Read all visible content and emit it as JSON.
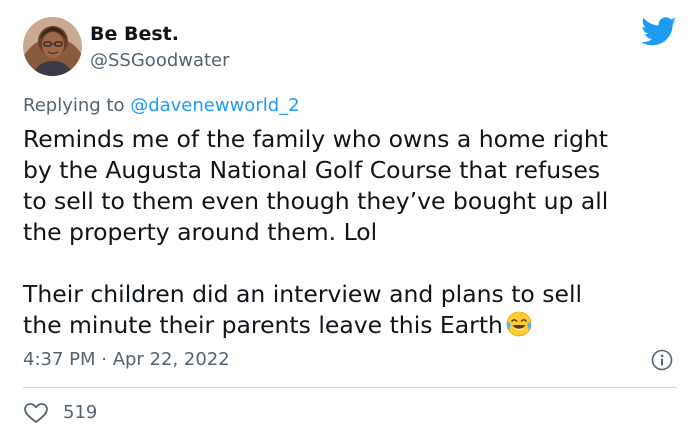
{
  "author": {
    "name": "Be Best.",
    "handle": "@SSGoodwater",
    "avatar_icon": "avatar-photo"
  },
  "platform_icon": "twitter-bird-icon",
  "reply": {
    "prefix": "Replying to ",
    "mention": "@davenewworld_2"
  },
  "tweet": {
    "paragraph1": "Reminds me of the family who owns a home right\nby the Augusta National Golf Course that refuses\nto sell to them even though they’ve bought up all\nthe property around them. Lol",
    "paragraph2": "Their children did an interview and plans to sell\nthe minute their parents leave this Earth",
    "emoji": "tears-of-joy-emoji"
  },
  "meta": {
    "timestamp": "4:37 PM · Apr 22, 2022",
    "info_icon": "info-icon"
  },
  "engagement": {
    "like_icon": "heart-icon",
    "likes": "519"
  },
  "colors": {
    "accent": "#1d9bf0",
    "secondary_text": "#536471",
    "divider": "#cfd9de"
  }
}
